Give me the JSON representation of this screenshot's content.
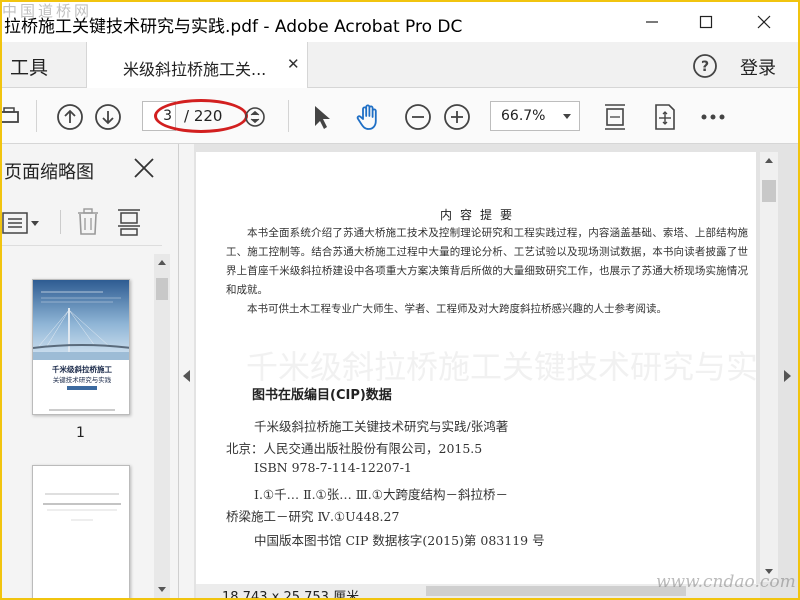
{
  "window": {
    "title": "拉桥施工关键技术研究与实践.pdf - Adobe Acrobat Pro DC",
    "watermark_top": "中国道桥网",
    "watermark_bottom": "www.cndao.com"
  },
  "tabs": {
    "tools": "工具",
    "document": "米级斜拉桥施工关...",
    "login": "登录"
  },
  "toolbar": {
    "current_page": "3",
    "page_total": "/ 220",
    "zoom": "66.7%"
  },
  "thumbnail_panel": {
    "title": "页面缩略图",
    "page_1_label": "1",
    "cover_title_1": "千米级斜拉桥施工",
    "cover_title_2": "关键技术研究与实践"
  },
  "document": {
    "summary_title": "内容提要",
    "summary_para_1": "本书全面系统介绍了苏通大桥施工技术及控制理论研究和工程实践过程，内容涵盖基础、索塔、上部结构施工、施工控制等。结合苏通大桥施工过程中大量的理论分析、工艺试验以及现场测试数据，本书向读者披露了世界上首座千米级斜拉桥建设中各项重大方案决策背后所做的大量细致研究工作，也展示了苏通大桥现场实施情况和成就。",
    "summary_para_2": "本书可供土木工程专业广大师生、学者、工程师及对大跨度斜拉桥感兴趣的人士参考阅读。",
    "cip_heading": "图书在版编目(CIP)数据",
    "cip_line_1": "千米级斜拉桥施工关键技术研究与实践/张鸿著",
    "cip_line_2": "北京：人民交通出版社股份有限公司，2015.5",
    "cip_line_3": "ISBN 978-7-114-12207-1",
    "cip_line_4": "Ⅰ.①千…  Ⅱ.①张…  Ⅲ.①大跨度结构－斜拉桥－",
    "cip_line_5": "桥梁施工－研究  Ⅳ.①U448.27",
    "cip_line_6": "中国版本图书馆 CIP 数据核字(2015)第 083119 号",
    "page_size": "18.743 x 25.753 厘米"
  },
  "colors": {
    "frame": "#f1c40f",
    "annotation_ellipse": "#d21f1f",
    "hand_tool": "#1f6fc5"
  }
}
